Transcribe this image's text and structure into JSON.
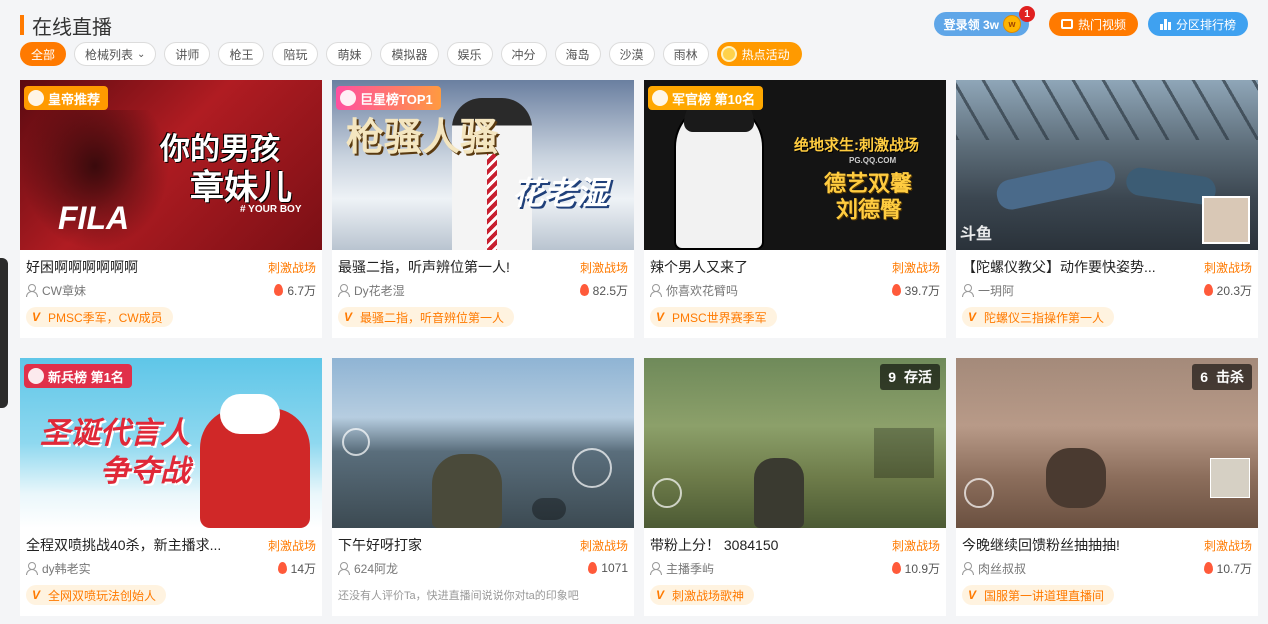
{
  "header": {
    "title": "在线直播"
  },
  "top_actions": {
    "login_label": "登录领 3w",
    "login_badge": "1",
    "hot_video_label": "热门视频",
    "rank_label": "分区排行榜"
  },
  "filters": [
    {
      "label": "全部",
      "active": true
    },
    {
      "label": "枪械列表",
      "dropdown": true
    },
    {
      "label": "讲师"
    },
    {
      "label": "枪王"
    },
    {
      "label": "陪玩"
    },
    {
      "label": "萌妹"
    },
    {
      "label": "模拟器"
    },
    {
      "label": "娱乐"
    },
    {
      "label": "冲分"
    },
    {
      "label": "海岛"
    },
    {
      "label": "沙漠"
    },
    {
      "label": "雨林"
    }
  ],
  "hot_activity_label": "热点活动",
  "cards": [
    {
      "tag": "皇帝推荐",
      "tag_color": "#ff9a00",
      "overlay": [
        "你的男孩",
        "章妹儿"
      ],
      "overlay_sub": "# YOUR BOY",
      "overlay_brand": "FILA",
      "title": "好困啊啊啊啊啊啊",
      "category": "刺激战场",
      "streamer": "CW章妹",
      "heat": "6.7万",
      "vtag": "PMSC季军，CW成员"
    },
    {
      "tag": "巨星榜TOP1",
      "tag_color": "#e0409a",
      "overlay": [
        "枪骚人骚"
      ],
      "overlay_sub": "花老湿",
      "title": "最骚二指，听声辨位第一人!",
      "category": "刺激战场",
      "streamer": "Dy花老湿",
      "heat": "82.5万",
      "vtag": "最骚二指，听音辨位第一人"
    },
    {
      "tag": "军官榜 第10名",
      "tag_color": "#ff9a00",
      "overlay": [
        "绝地求生:刺激战场",
        "德艺双馨",
        "刘德臀"
      ],
      "overlay_sub": "PG.QQ.COM",
      "title": "辣个男人又来了",
      "category": "刺激战场",
      "streamer": "你喜欢花臂吗",
      "heat": "39.7万",
      "vtag": "PMSC世界赛季军"
    },
    {
      "title": "【陀螺仪教父】动作要快姿势...",
      "category": "刺激战场",
      "streamer": "一玥阿",
      "heat": "20.3万",
      "vtag": "陀螺仪三指操作第一人",
      "watermark": "斗鱼"
    },
    {
      "tag": "新兵榜 第1名",
      "tag_color": "#e0304a",
      "overlay": [
        "圣诞代言人",
        "争夺战"
      ],
      "title": "全程双喷挑战40杀，新主播求...",
      "category": "刺激战场",
      "streamer": "dy韩老实",
      "heat": "14万",
      "vtag": "全网双喷玩法创始人"
    },
    {
      "title": "下午好呀打家",
      "category": "刺激战场",
      "streamer": "624阿龙",
      "heat": "1071",
      "no_review": "还没有人评价Ta，快进直播间说说你对ta的印象吧"
    },
    {
      "title": "带粉上分！ 3084150",
      "category": "刺激战场",
      "streamer": "主播季屿",
      "heat": "10.9万",
      "vtag": "刺激战场歌神",
      "counter": {
        "number": "9",
        "label": "存活"
      }
    },
    {
      "title": "今晚继续回馈粉丝抽抽抽!",
      "category": "刺激战场",
      "streamer": "肉丝叔叔",
      "heat": "10.7万",
      "vtag": "国服第一讲道理直播间",
      "counter": {
        "number": "6",
        "label": "击杀"
      }
    }
  ],
  "colors": {
    "accent": "#ff7a00",
    "blue": "#3fa1f0"
  }
}
